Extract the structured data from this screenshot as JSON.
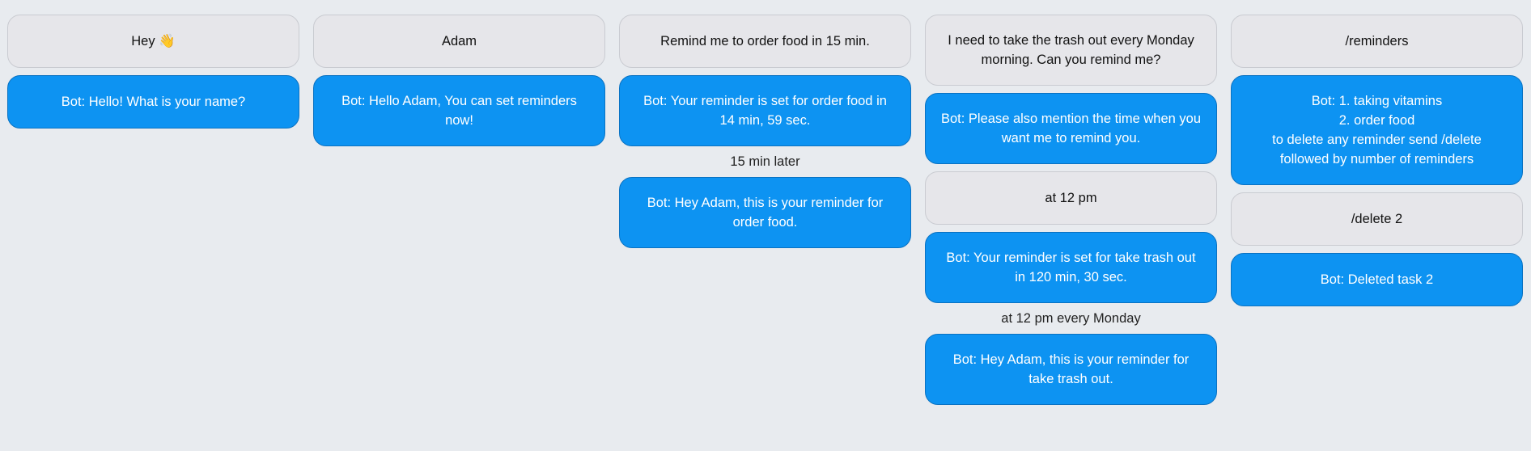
{
  "columns": [
    {
      "messages": [
        {
          "kind": "user",
          "text": "Hey 👋"
        },
        {
          "kind": "bot",
          "text": "Bot: Hello! What is your name?"
        }
      ]
    },
    {
      "messages": [
        {
          "kind": "user",
          "text": "Adam"
        },
        {
          "kind": "bot",
          "text": "Bot: Hello Adam, You can set reminders now!"
        }
      ]
    },
    {
      "messages": [
        {
          "kind": "user",
          "text": "Remind me to order food in 15 min."
        },
        {
          "kind": "bot",
          "text": "Bot: Your reminder is set for order food in 14 min, 59 sec."
        },
        {
          "kind": "note",
          "text": "15 min later"
        },
        {
          "kind": "bot",
          "text": "Bot: Hey Adam, this is your reminder for order food."
        }
      ]
    },
    {
      "messages": [
        {
          "kind": "user",
          "text": "I need to take the trash out every Monday morning. Can you remind me?"
        },
        {
          "kind": "bot",
          "text": "Bot: Please also mention the time when you want me to remind you."
        },
        {
          "kind": "user",
          "text": "at 12 pm"
        },
        {
          "kind": "bot",
          "text": "Bot: Your reminder is set for take trash out in 120 min, 30 sec."
        },
        {
          "kind": "note",
          "text": "at 12 pm every Monday"
        },
        {
          "kind": "bot",
          "text": "Bot: Hey Adam, this is your reminder for take trash out."
        }
      ]
    },
    {
      "messages": [
        {
          "kind": "user",
          "text": "/reminders"
        },
        {
          "kind": "bot",
          "text": "Bot: 1. taking vitamins\n2. order food\nto delete any reminder send /delete followed by number of reminders"
        },
        {
          "kind": "user",
          "text": "/delete 2"
        },
        {
          "kind": "bot",
          "text": "Bot: Deleted task 2"
        }
      ]
    }
  ]
}
